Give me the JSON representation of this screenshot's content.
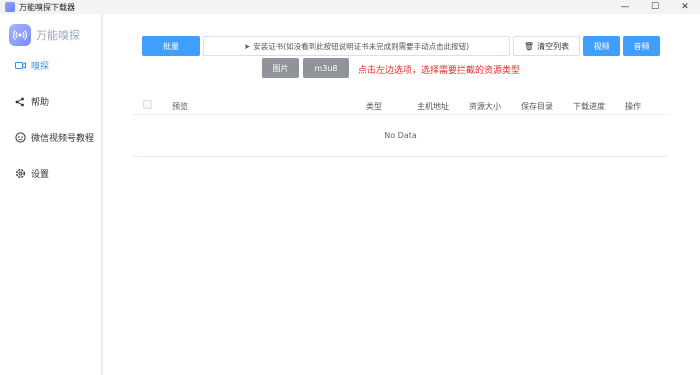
{
  "window": {
    "title": "万能嗅探下载器",
    "minimize": "—",
    "maximize": "☐",
    "close": "✕"
  },
  "brand": {
    "name": "万能嗅探"
  },
  "nav": [
    {
      "label": "嗅探",
      "icon": "camera-icon",
      "active": true
    },
    {
      "label": "帮助",
      "icon": "share-icon",
      "active": false
    },
    {
      "label": "微信视频号教程",
      "icon": "wechat-icon",
      "active": false
    },
    {
      "label": "设置",
      "icon": "gear-icon",
      "active": false
    }
  ],
  "toolbar": {
    "batch_label": "批量",
    "install_label": "安装证书(如没看到此按钮说明证书未完成则需要手动点击此按钮)",
    "clear_label": "清空列表",
    "video_label": "视频",
    "audio_label": "音频",
    "image_label": "图片",
    "m3u8_label": "m3u8",
    "hint": "点击左边选项，选择需要拦截的资源类型"
  },
  "table": {
    "columns": [
      "预览",
      "类型",
      "主机地址",
      "资源大小",
      "保存目录",
      "下载进度",
      "操作"
    ],
    "empty_text": "No Data"
  },
  "colors": {
    "accent": "#409eff",
    "gray_button": "#909399",
    "hint_red": "#e62c2c"
  }
}
